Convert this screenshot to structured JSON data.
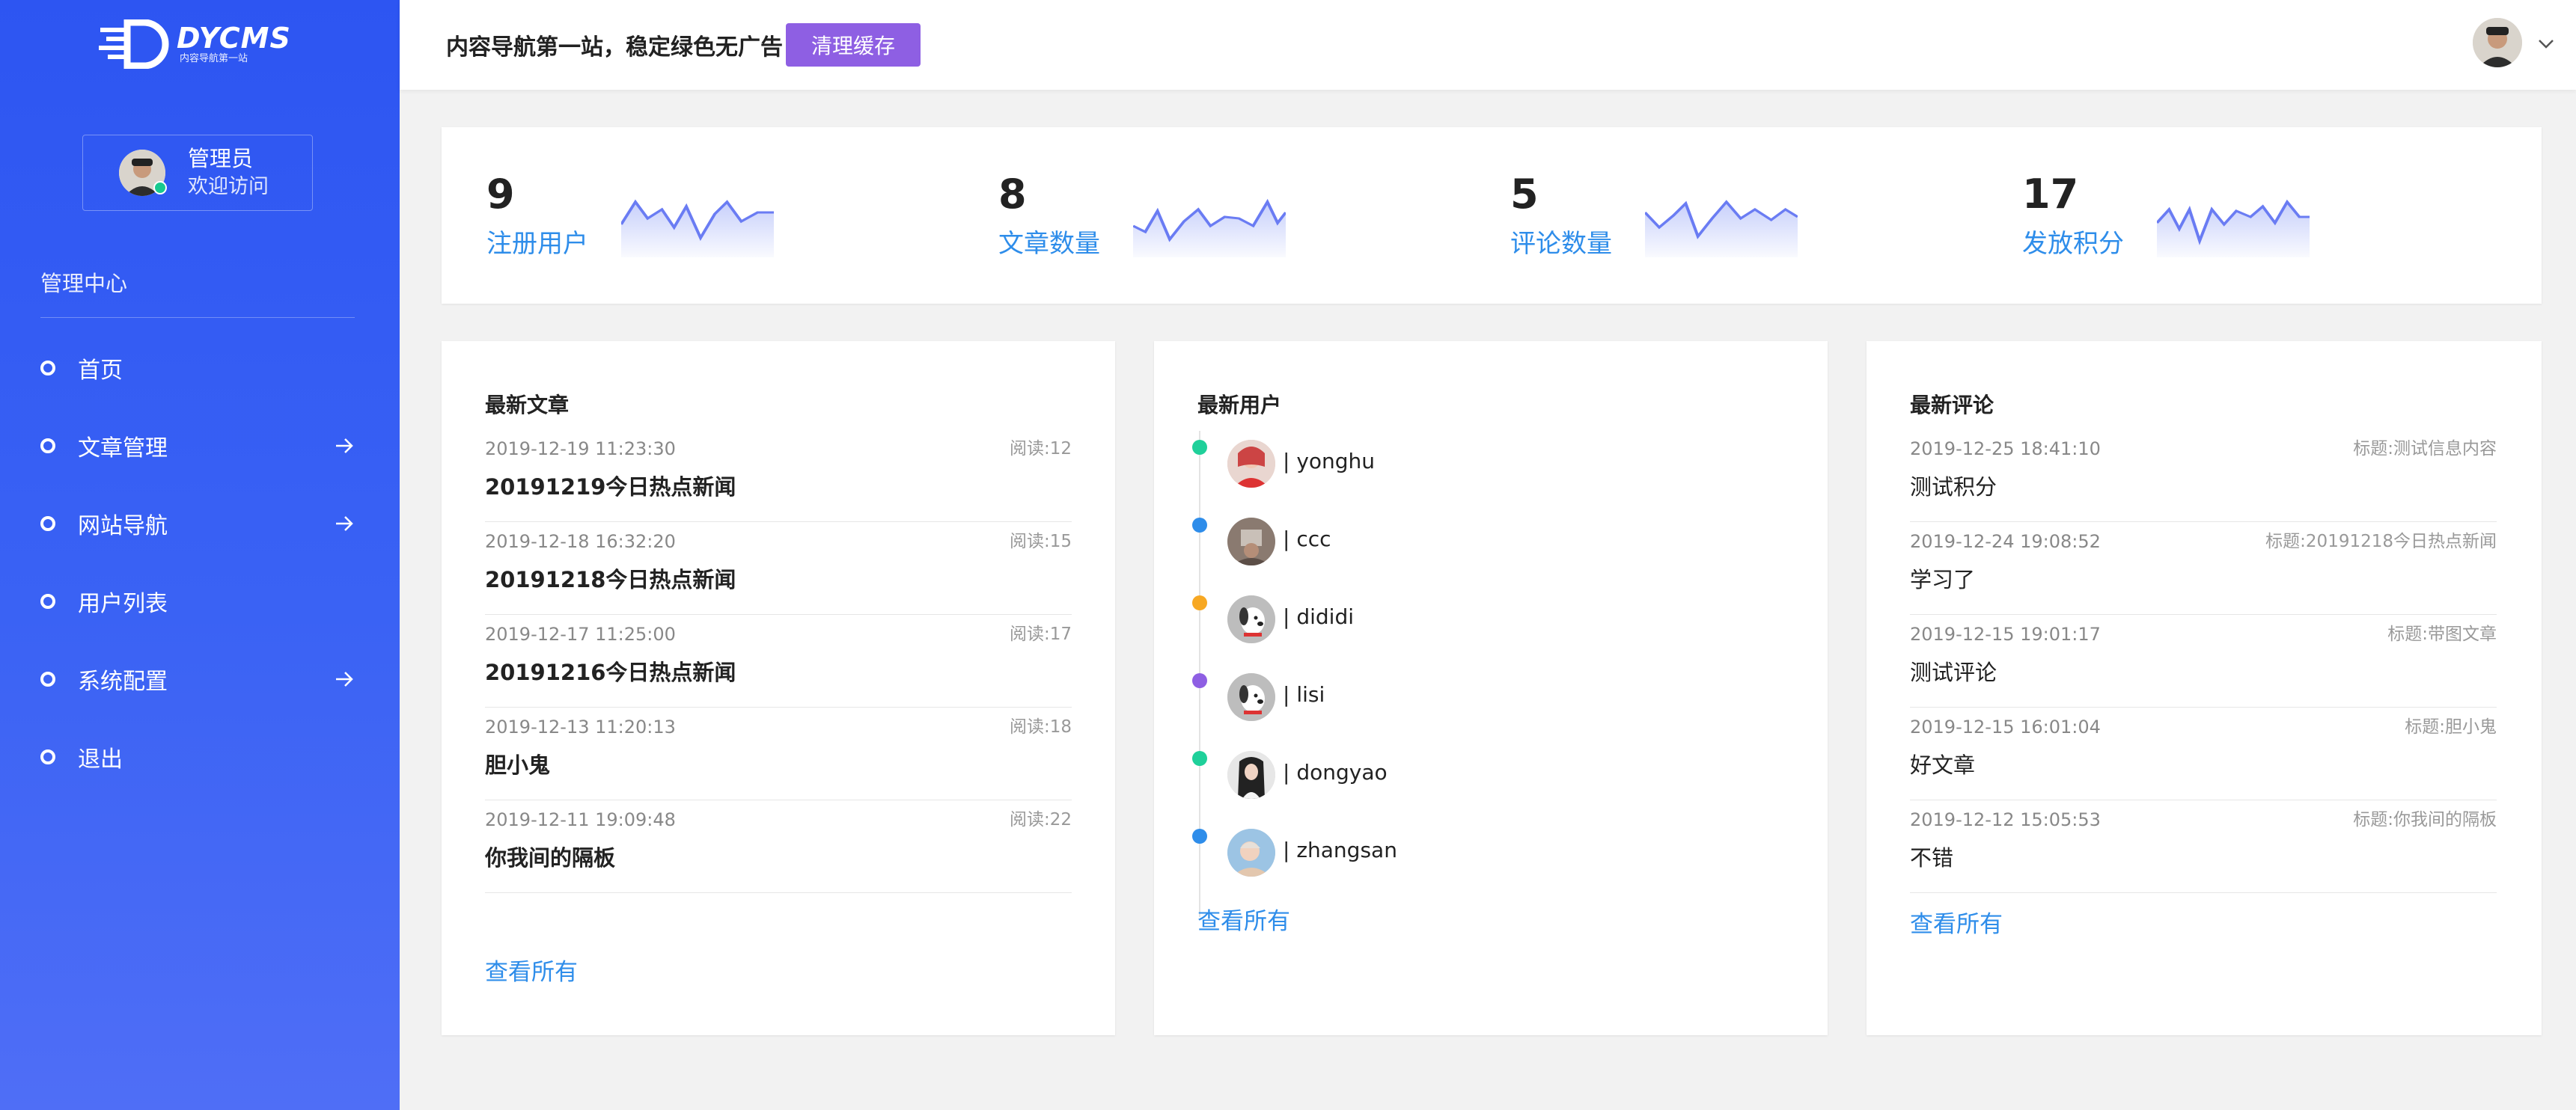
{
  "sidebar": {
    "logo_name": "DYCMS",
    "logo_sub": "内容导航第一站",
    "user": {
      "name": "管理员",
      "welcome": "欢迎访问"
    },
    "menu_title": "管理中心",
    "items": [
      {
        "label": "首页",
        "has_arrow": false
      },
      {
        "label": "文章管理",
        "has_arrow": true
      },
      {
        "label": "网站导航",
        "has_arrow": true
      },
      {
        "label": "用户列表",
        "has_arrow": false
      },
      {
        "label": "系统配置",
        "has_arrow": true
      },
      {
        "label": "退出",
        "has_arrow": false
      }
    ]
  },
  "header": {
    "notice": "内容导航第一站，稳定绿色无广告",
    "clear_cache_label": "清理缓存"
  },
  "stats": [
    {
      "value": "9",
      "label": "注册用户"
    },
    {
      "value": "8",
      "label": "文章数量"
    },
    {
      "value": "5",
      "label": "评论数量"
    },
    {
      "value": "17",
      "label": "发放积分"
    }
  ],
  "articles": {
    "title": "最新文章",
    "items": [
      {
        "date": "2019-12-19 11:23:30",
        "reads": "阅读:12",
        "title": "20191219今日热点新闻"
      },
      {
        "date": "2019-12-18 16:32:20",
        "reads": "阅读:15",
        "title": "20191218今日热点新闻"
      },
      {
        "date": "2019-12-17 11:25:00",
        "reads": "阅读:17",
        "title": "20191216今日热点新闻"
      },
      {
        "date": "2019-12-13 11:20:13",
        "reads": "阅读:18",
        "title": "胆小鬼"
      },
      {
        "date": "2019-12-11 19:09:48",
        "reads": "阅读:22",
        "title": "你我间的隔板"
      }
    ],
    "view_all": "查看所有"
  },
  "users": {
    "title": "最新用户",
    "items": [
      {
        "name": "| yonghu",
        "dot_color": "#1fd09a"
      },
      {
        "name": "| ccc",
        "dot_color": "#2e8dea"
      },
      {
        "name": "| dididi",
        "dot_color": "#f7a823"
      },
      {
        "name": "| lisi",
        "dot_color": "#8e5fe3"
      },
      {
        "name": "| dongyao",
        "dot_color": "#1fd09a"
      },
      {
        "name": "| zhangsan",
        "dot_color": "#2e8dea"
      }
    ],
    "view_all": "查看所有"
  },
  "comments": {
    "title": "最新评论",
    "items": [
      {
        "date": "2019-12-25 18:41:10",
        "target": "标题:测试信息内容",
        "text": "测试积分"
      },
      {
        "date": "2019-12-24 19:08:52",
        "target": "标题:20191218今日热点新闻",
        "text": "学习了"
      },
      {
        "date": "2019-12-15 19:01:17",
        "target": "标题:带图文章",
        "text": "测试评论"
      },
      {
        "date": "2019-12-15 16:01:04",
        "target": "标题:胆小鬼",
        "text": "好文章"
      },
      {
        "date": "2019-12-12 15:05:53",
        "target": "标题:你我间的隔板",
        "text": "不错"
      }
    ],
    "view_all": "查看所有"
  },
  "colors": {
    "sidebar_top": "#2d55f2",
    "sidebar_bottom": "#4f6ef6",
    "accent_link": "#2e8dea",
    "button_purple": "#8e5fe3",
    "spark_line": "#6a7cf3"
  }
}
